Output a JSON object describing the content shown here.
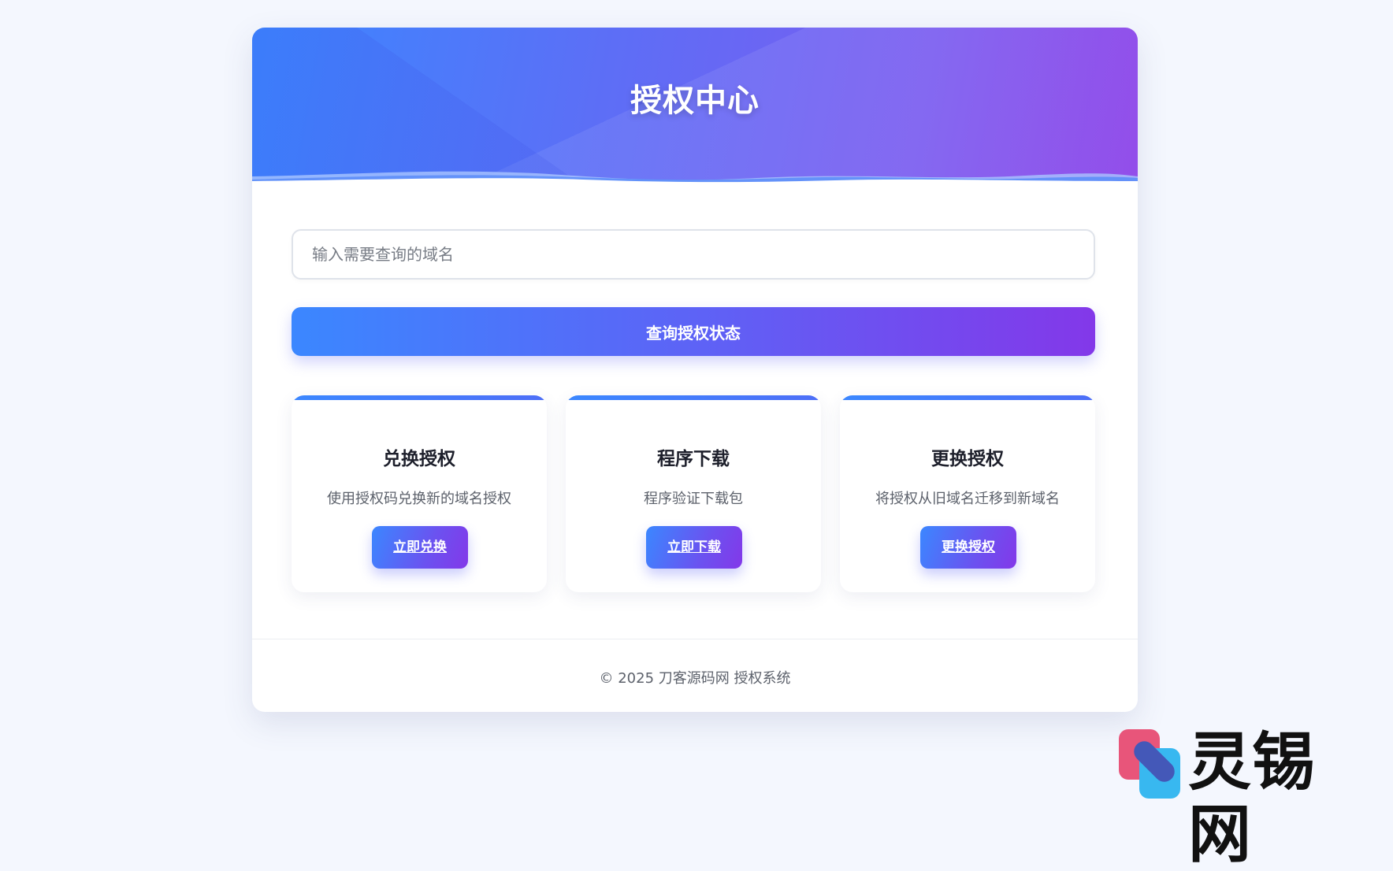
{
  "header": {
    "title": "授权中心"
  },
  "search": {
    "placeholder": "输入需要查询的域名",
    "value": ""
  },
  "query_button": {
    "label": "查询授权状态"
  },
  "features": [
    {
      "title": "兑换授权",
      "description": "使用授权码兑换新的域名授权",
      "button": "立即兑换"
    },
    {
      "title": "程序下载",
      "description": "程序验证下载包",
      "button": "立即下载"
    },
    {
      "title": "更换授权",
      "description": "将授权从旧域名迁移到新域名",
      "button": "更换授权"
    }
  ],
  "footer": {
    "text": "© 2025 刀客源码网 授权系统"
  },
  "watermark": {
    "text": "灵锡网"
  },
  "colors": {
    "page_background": "#f4f7fe",
    "gradient_start": "#3b87ff",
    "gradient_end": "#8338e9"
  }
}
